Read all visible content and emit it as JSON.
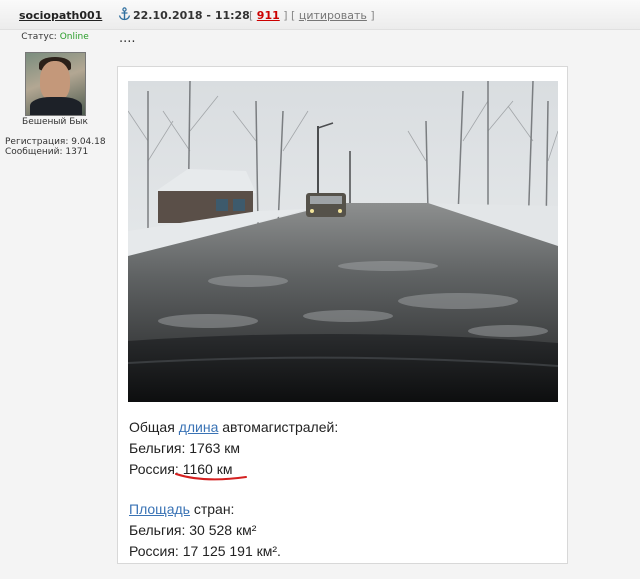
{
  "post": {
    "username": "sociopath001",
    "date": "22.10.2018 - 11:28",
    "bracket_open": "[",
    "post_number": "911",
    "bracket_mid": "] [",
    "quote_label": "цитировать",
    "bracket_close": "]",
    "dots": "...."
  },
  "user": {
    "status_label": "Статус:",
    "status_value": "Online",
    "rank": "Бешеный Бык",
    "registration": "Регистрация: 9.04.18",
    "messages": "Сообщений: 1371"
  },
  "content": {
    "line1_pre": "Общая ",
    "line1_link": "длина",
    "line1_post": " автомагистралей:",
    "line2": "Бельгия: 1763 км",
    "line3_pre": "Россия: ",
    "line3_value": "1160 км",
    "line4_link": "Площадь",
    "line4_post": " стран:",
    "line5": "Бельгия: 30 528 км²",
    "line6": "Россия: 17 125 191 км²."
  },
  "colors": {
    "online": "#2a9d2a",
    "post_number": "#cc0000",
    "link": "#3a73b5",
    "underline_mark": "#d42020"
  },
  "icons": {
    "anchor": "anchor-icon"
  }
}
